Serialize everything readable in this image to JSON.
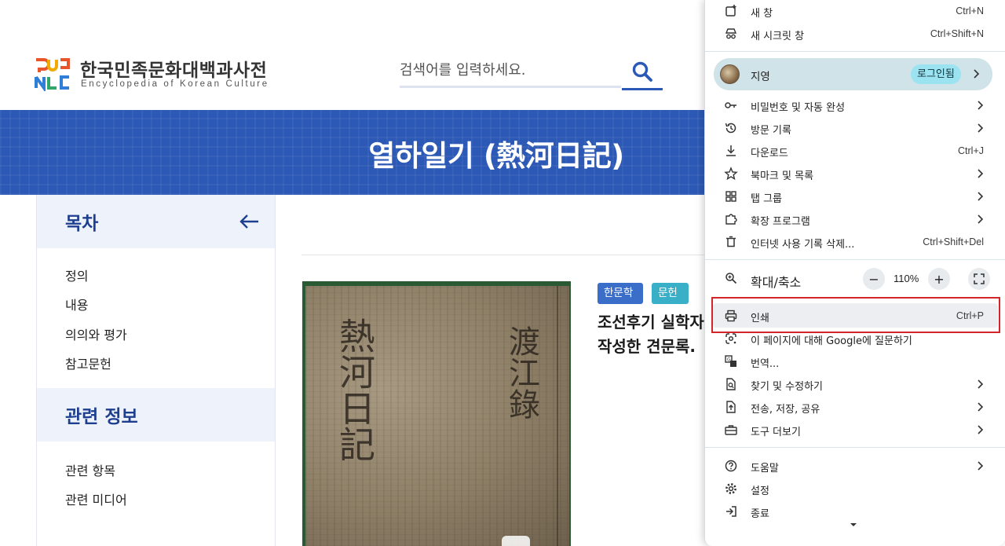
{
  "site": {
    "logo_title": "한국민족문화대백과사전",
    "logo_subtitle": "Encyclopedia of Korean Culture",
    "search_placeholder": "검색어를 입력하세요.",
    "page_title": "열하일기 (熱河日記)"
  },
  "sidebar": {
    "toc_heading": "목차",
    "toc_items": [
      "정의",
      "내용",
      "의의와 평가",
      "참고문헌"
    ],
    "related_heading": "관련 정보",
    "related_items": [
      "관련 항목",
      "관련 미디어"
    ]
  },
  "article": {
    "tags": [
      "한문학",
      "문헌"
    ],
    "summary_lines": [
      "조선후기 실학자",
      "작성한 견문록."
    ],
    "artifact_image": "manuscript-cover-image"
  },
  "menu": {
    "top_items": [
      {
        "label": "새 창",
        "shortcut": "Ctrl+N",
        "icon": "new-window-icon"
      },
      {
        "label": "새 시크릿 창",
        "shortcut": "Ctrl+Shift+N",
        "icon": "incognito-icon"
      }
    ],
    "profile": {
      "name": "지영",
      "badge": "로그인됨"
    },
    "mid_items": [
      {
        "label": "비밀번호 및 자동 완성",
        "icon": "key-icon",
        "submenu": true
      },
      {
        "label": "방문 기록",
        "icon": "history-icon",
        "submenu": true
      },
      {
        "label": "다운로드",
        "icon": "download-icon",
        "shortcut": "Ctrl+J"
      },
      {
        "label": "북마크 및 목록",
        "icon": "star-icon",
        "submenu": true
      },
      {
        "label": "탭 그룹",
        "icon": "tab-groups-icon",
        "submenu": true
      },
      {
        "label": "확장 프로그램",
        "icon": "puzzle-icon",
        "submenu": true
      },
      {
        "label": "인터넷 사용 기록 삭제...",
        "icon": "trash-icon",
        "shortcut": "Ctrl+Shift+Del"
      }
    ],
    "zoom": {
      "label": "확대/축소",
      "value": "110%",
      "minus": "−",
      "plus": "+"
    },
    "tool_items": [
      {
        "label": "인쇄",
        "icon": "print-icon",
        "shortcut": "Ctrl+P"
      },
      {
        "label": "이 페이지에 대해 Google에 질문하기",
        "icon": "google-lens-icon"
      },
      {
        "label": "번역...",
        "icon": "translate-icon"
      },
      {
        "label": "찾기 및 수정하기",
        "icon": "find-icon",
        "submenu": true
      },
      {
        "label": "전송, 저장, 공유",
        "icon": "share-icon",
        "submenu": true
      },
      {
        "label": "도구 더보기",
        "icon": "toolbox-icon",
        "submenu": true
      }
    ],
    "bottom_items": [
      {
        "label": "도움말",
        "icon": "help-icon",
        "submenu": true
      },
      {
        "label": "설정",
        "icon": "gear-icon"
      },
      {
        "label": "종료",
        "icon": "exit-icon"
      }
    ]
  },
  "colors": {
    "brand_blue": "#2c59b5",
    "menu_highlight_border": "#d2262a",
    "tag_blue": "#3b6ec9",
    "tag_teal": "#3aafc8"
  }
}
